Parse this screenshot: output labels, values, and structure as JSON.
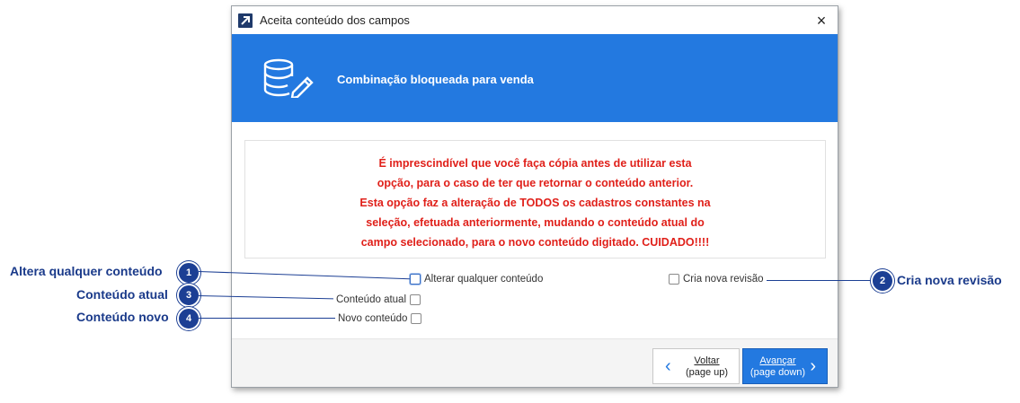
{
  "window": {
    "title": "Aceita conteúdo dos campos",
    "close_icon": "×"
  },
  "banner": {
    "text": "Combinação bloqueada para venda"
  },
  "warning": {
    "lines": [
      "É imprescindível que você faça cópia antes de utilizar esta",
      "opção, para o caso de ter que retornar o conteúdo anterior.",
      "Esta opção faz a alteração de TODOS os cadastros constantes na",
      "seleção, efetuada anteriormente, mudando o conteúdo atual do",
      "campo selecionado, para o novo conteúdo digitado. CUIDADO!!!!"
    ]
  },
  "options": {
    "alterar": "Alterar qualquer conteúdo",
    "revisao": "Cria nova revisão",
    "atual": "Conteúdo atual",
    "novo": "Novo conteúdo"
  },
  "footer": {
    "back_line1": "Voltar",
    "back_line2": "(page up)",
    "next_line1": "Avançar",
    "next_line2": "(page down)"
  },
  "annotations": {
    "a1": {
      "num": "1",
      "label": "Altera qualquer conteúdo"
    },
    "a2": {
      "num": "2",
      "label": "Cria nova revisão"
    },
    "a3": {
      "num": "3",
      "label": "Conteúdo atual"
    },
    "a4": {
      "num": "4",
      "label": "Conteúdo novo"
    }
  },
  "colors": {
    "accent": "#2379e0",
    "warning": "#e0201a",
    "callout": "#1c3f94"
  }
}
